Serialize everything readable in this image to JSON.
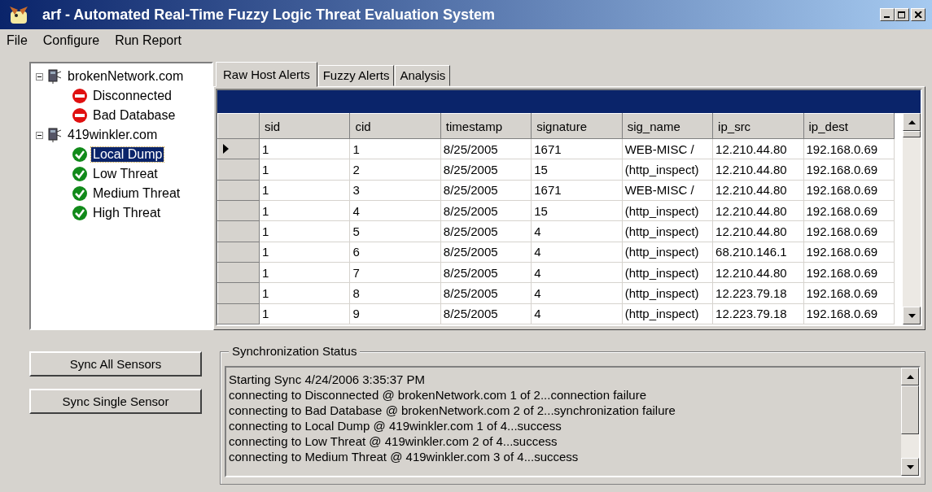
{
  "window": {
    "title": "arf - Automated Real-Time Fuzzy Logic Threat Evaluation System"
  },
  "menu": [
    "File",
    "Configure",
    "Run Report"
  ],
  "tree": [
    {
      "label": "brokenNetwork.com",
      "expanded": true,
      "children": [
        {
          "label": "Disconnected",
          "kind": "error",
          "selected": false
        },
        {
          "label": "Bad Database",
          "kind": "error",
          "selected": false
        }
      ]
    },
    {
      "label": "419winkler.com",
      "expanded": true,
      "children": [
        {
          "label": "Local Dump",
          "kind": "ok",
          "selected": true
        },
        {
          "label": "Low Threat",
          "kind": "ok",
          "selected": false
        },
        {
          "label": "Medium Threat",
          "kind": "ok",
          "selected": false
        },
        {
          "label": "High Threat",
          "kind": "ok",
          "selected": false
        }
      ]
    }
  ],
  "tabs": [
    {
      "label": "Raw Host Alerts",
      "selected": true
    },
    {
      "label": "Fuzzy Alerts",
      "selected": false
    },
    {
      "label": "Analysis",
      "selected": false
    }
  ],
  "table": {
    "columns": [
      "sid",
      "cid",
      "timestamp",
      "signature",
      "sig_name",
      "ip_src",
      "ip_dest"
    ],
    "rows": [
      {
        "selected": true,
        "cells": [
          "1",
          "1",
          "8/25/2005",
          "1671",
          "WEB-MISC /",
          "12.210.44.80",
          "192.168.0.69"
        ]
      },
      {
        "selected": false,
        "cells": [
          "1",
          "2",
          "8/25/2005",
          "15",
          "(http_inspect)",
          "12.210.44.80",
          "192.168.0.69"
        ]
      },
      {
        "selected": false,
        "cells": [
          "1",
          "3",
          "8/25/2005",
          "1671",
          "WEB-MISC /",
          "12.210.44.80",
          "192.168.0.69"
        ]
      },
      {
        "selected": false,
        "cells": [
          "1",
          "4",
          "8/25/2005",
          "15",
          "(http_inspect)",
          "12.210.44.80",
          "192.168.0.69"
        ]
      },
      {
        "selected": false,
        "cells": [
          "1",
          "5",
          "8/25/2005",
          "4",
          "(http_inspect)",
          "12.210.44.80",
          "192.168.0.69"
        ]
      },
      {
        "selected": false,
        "cells": [
          "1",
          "6",
          "8/25/2005",
          "4",
          "(http_inspect)",
          "68.210.146.1",
          "192.168.0.69"
        ]
      },
      {
        "selected": false,
        "cells": [
          "1",
          "7",
          "8/25/2005",
          "4",
          "(http_inspect)",
          "12.210.44.80",
          "192.168.0.69"
        ]
      },
      {
        "selected": false,
        "cells": [
          "1",
          "8",
          "8/25/2005",
          "4",
          "(http_inspect)",
          "12.223.79.18",
          "192.168.0.69"
        ]
      },
      {
        "selected": false,
        "cells": [
          "1",
          "9",
          "8/25/2005",
          "4",
          "(http_inspect)",
          "12.223.79.18",
          "192.168.0.69"
        ]
      }
    ]
  },
  "buttons": [
    "Sync All Sensors",
    "Sync Single Sensor"
  ],
  "sync_status": {
    "title": "Synchronization Status",
    "lines": [
      "Starting Sync 4/24/2006 3:35:37 PM",
      "connecting to Disconnected @ brokenNetwork.com 1 of 2...connection failure",
      "connecting to Bad Database @ brokenNetwork.com 2 of 2...synchronization failure",
      "connecting to Local Dump @ 419winkler.com 1 of 4...success",
      "connecting to Low Threat @ 419winkler.com 2 of 4...success",
      "connecting to Medium Threat @ 419winkler.com 3 of 4...success"
    ]
  }
}
